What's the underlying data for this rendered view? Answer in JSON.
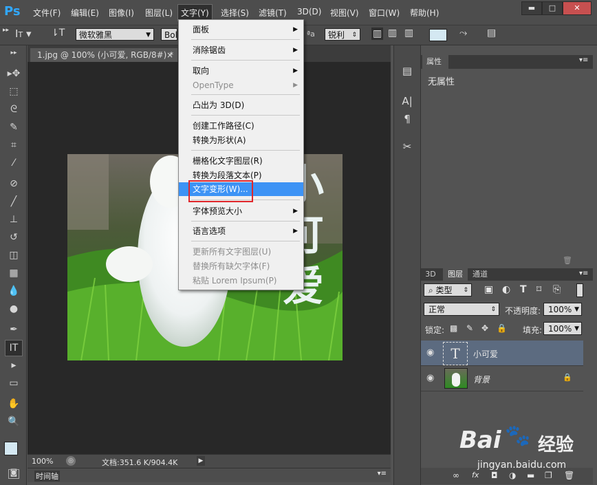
{
  "app": {
    "logo": "Ps"
  },
  "menubar": {
    "items": [
      "文件(F)",
      "编辑(E)",
      "图像(I)",
      "图层(L)",
      "文字(Y)",
      "选择(S)",
      "滤镜(T)",
      "3D(D)",
      "视图(V)",
      "窗口(W)",
      "帮助(H)"
    ],
    "active_index": 4
  },
  "options": {
    "font_family": "微软雅黑",
    "font_style": "Bold",
    "aa_label": "ªa",
    "antialias": "锐利"
  },
  "document": {
    "tab_title": "1.jpg @ 100% (小可爱, RGB/8#) *",
    "tab_close": "×",
    "overlay_text": [
      "小",
      "可",
      "爱"
    ],
    "zoom": "100%",
    "doc_info": "文档:351.6 K/904.4K",
    "timeline_label": "时间轴"
  },
  "type_menu": {
    "items": [
      {
        "label": "面板",
        "submenu": true,
        "disabled": false
      },
      {
        "label": "消除锯齿",
        "submenu": true,
        "disabled": false
      },
      {
        "label": "取向",
        "submenu": true,
        "disabled": false
      },
      {
        "label": "OpenType",
        "submenu": true,
        "disabled": true
      },
      {
        "label": "凸出为 3D(D)",
        "submenu": false,
        "disabled": false
      },
      {
        "label": "创建工作路径(C)",
        "submenu": false,
        "disabled": false
      },
      {
        "label": "转换为形状(A)",
        "submenu": false,
        "disabled": false
      },
      {
        "label": "栅格化文字图层(R)",
        "submenu": false,
        "disabled": false
      },
      {
        "label": "转换为段落文本(P)",
        "submenu": false,
        "disabled": false
      },
      {
        "label": "文字变形(W)...",
        "submenu": false,
        "disabled": false,
        "highlighted": true
      },
      {
        "label": "字体预览大小",
        "submenu": true,
        "disabled": false
      },
      {
        "label": "语言选项",
        "submenu": true,
        "disabled": false
      },
      {
        "label": "更新所有文字图层(U)",
        "submenu": false,
        "disabled": true
      },
      {
        "label": "替换所有缺欠字体(F)",
        "submenu": false,
        "disabled": true
      },
      {
        "label": "粘贴 Lorem Ipsum(P)",
        "submenu": false,
        "disabled": true
      }
    ]
  },
  "properties": {
    "tab": "属性",
    "empty_text": "无属性"
  },
  "layers_panel": {
    "tabs": [
      "3D",
      "图层",
      "通道"
    ],
    "active_tab": "图层",
    "filter_kind": "类型",
    "blend_mode": "正常",
    "opacity_label": "不透明度:",
    "opacity": "100%",
    "lock_label": "锁定:",
    "fill_label": "填充:",
    "fill": "100%",
    "layers": [
      {
        "name": "小可爱",
        "type": "text",
        "thumb": "T",
        "selected": true
      },
      {
        "name": "背景",
        "type": "image",
        "locked": true,
        "selected": false
      }
    ]
  },
  "watermark": {
    "brand": "Bai",
    "brand_cn": "经验",
    "url": "jingyan.baidu.com"
  },
  "colors": {
    "accent": "#3d93f5",
    "highlight_box": "#e0262b",
    "menubar": "#4d4d4d",
    "canvas": "#282828"
  }
}
